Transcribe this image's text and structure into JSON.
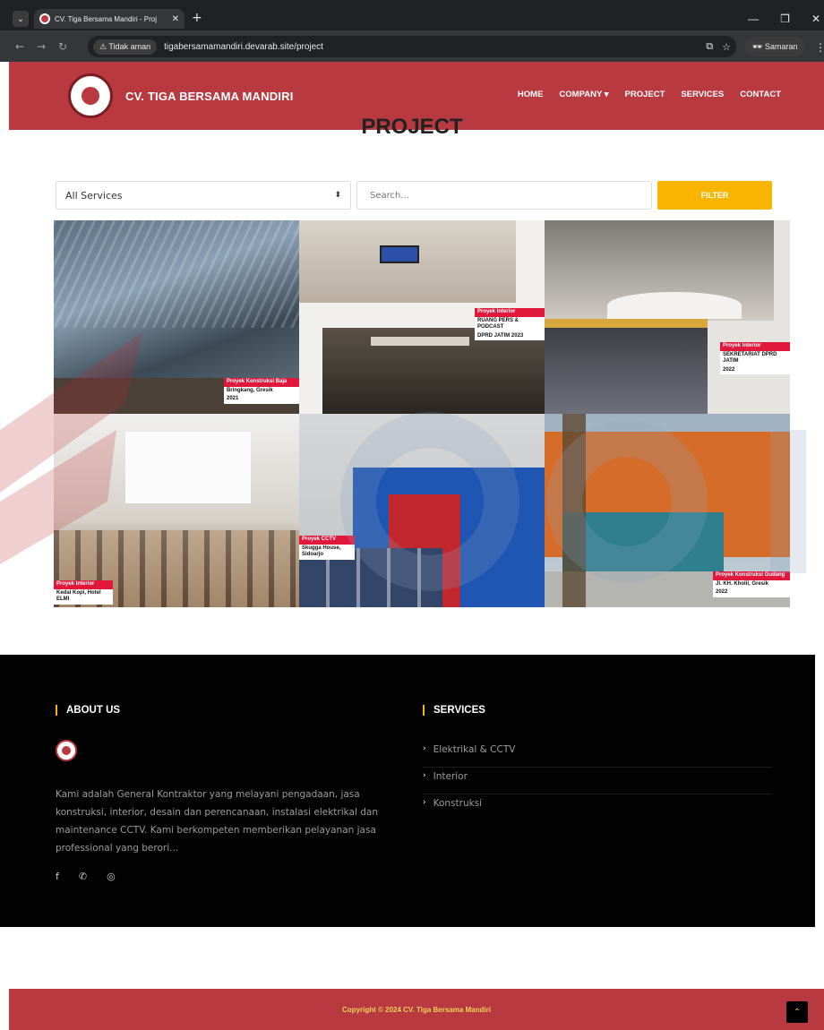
{
  "browser": {
    "tab_title": "CV. Tiga Bersama Mandiri - Proj",
    "security_label": "Tidak aman",
    "url": "tigabersamamandiri.devarab.site/project",
    "profile_label": "Samaran"
  },
  "header": {
    "brand": "CV. TIGA BERSAMA MANDIRI",
    "nav": [
      {
        "label": "HOME"
      },
      {
        "label": "COMPANY ▾"
      },
      {
        "label": "PROJECT"
      },
      {
        "label": "SERVICES"
      },
      {
        "label": "CONTACT"
      }
    ]
  },
  "main": {
    "title": "PROJECT",
    "filter": {
      "select_value": "All Services",
      "search_placeholder": "Search...",
      "button_label": "FILTER"
    },
    "gallery": [
      {
        "caption1": "Proyek Konstruksi Baja",
        "caption2": "Bringkang, Gresik",
        "caption3": "2021"
      },
      {
        "caption1": "Proyek Interior",
        "caption2": "RUANG PERS & PODCAST",
        "caption3": "DPRD JATIM 2023"
      },
      {
        "caption1": "Proyek Interior",
        "caption2": "SEKRETARIAT DPRD JATIM",
        "caption3": "2022"
      },
      {
        "caption1": "Proyek Interior",
        "caption2": "Kedai Kopi, Hotel ELMI",
        "caption3": ""
      },
      {
        "caption1": "Proyek CCTV",
        "caption2": "Skugga House, Sidoarjo",
        "caption3": ""
      },
      {
        "caption1": "Proyek Konstruksi Gudang",
        "caption2": "Jl. KH. Kholil, Gresik",
        "caption3": "2022"
      }
    ]
  },
  "footer": {
    "about_heading": "ABOUT US",
    "about_text": "Kami adalah General Kontraktor yang melayani pengadaan, jasa konstruksi, interior, desain dan perencanaan, instalasi elektrikal dan maintenance CCTV. Kami berkompeten memberikan pelayanan jasa professional yang berori...",
    "services_heading": "SERVICES",
    "services": [
      "Elektrikal & CCTV",
      "Interior",
      "Konstruksi"
    ],
    "copyright": "Copyright © 2024 CV. Tiga Bersama Mandiri"
  }
}
